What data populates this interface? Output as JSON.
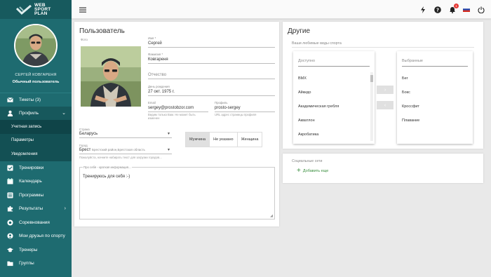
{
  "brand": {
    "line1": "WEB",
    "line2": "SPORT",
    "line3": "PLAN"
  },
  "user": {
    "name": "СЕРГЕЙ КОВГАРЕНЯ",
    "role": "Обычный пользователь"
  },
  "sidebar": {
    "items": [
      {
        "label": "Тикеты (3)",
        "icon": "mail-icon"
      },
      {
        "label": "Профиль",
        "icon": "person-icon"
      },
      {
        "label": "Учетная запись"
      },
      {
        "label": "Параметры"
      },
      {
        "label": "Уведомления"
      },
      {
        "label": "Тренировки",
        "icon": "check-square-icon"
      },
      {
        "label": "Календарь",
        "icon": "calendar-icon"
      },
      {
        "label": "Программы",
        "icon": "list-icon"
      },
      {
        "label": "Результаты",
        "icon": "puzzle-icon"
      },
      {
        "label": "Соревнования",
        "icon": "trophy-icon"
      },
      {
        "label": "Мои друзья по спорту",
        "icon": "friends-icon"
      },
      {
        "label": "Тренеры",
        "icon": "graduation-icon"
      },
      {
        "label": "Группы",
        "icon": "folder-icon"
      }
    ]
  },
  "topbar": {
    "notification_count": "1"
  },
  "profile_form": {
    "title": "Пользователь",
    "photo_label": "Фото",
    "first_name": {
      "label": "Имя *",
      "value": "Сергей"
    },
    "last_name": {
      "label": "Фамилия *",
      "value": "Ковгареня"
    },
    "patronymic": {
      "label": "Отчество"
    },
    "birthday": {
      "label": "День рождения",
      "value": "27 окт. 1975 г."
    },
    "email": {
      "label": "Email",
      "value": "sergey@prostobzor.com",
      "hint": "Видим только Вам. Не может быть изменен"
    },
    "profile": {
      "label": "Профиль",
      "value": "prosto-sergey",
      "hint": "URL адрес страницы профиля"
    },
    "country": {
      "label": "Страна",
      "value": "Беларусь"
    },
    "city": {
      "label": "Город",
      "value": "Брест",
      "region": "Брестский район,Брестская область",
      "hint": "Пожалуйста, начните набирать текст для загрузки городов..."
    },
    "gender": {
      "options": [
        "Мужчина",
        "Не указано",
        "Женщина"
      ],
      "selected": "Мужчина"
    },
    "about": {
      "label": "Про себя - краткая информация...",
      "value": "Тренируюсь для себя :-)"
    }
  },
  "other": {
    "title": "Другие",
    "sports_label": "Ваши любимые виды спорта",
    "available_header": "Доступно",
    "available_items": [
      "BMX",
      "Айкидо",
      "Академическая гребля",
      "Акватлон",
      "Акробатика"
    ],
    "selected_header": "Выбранные",
    "selected_items": [
      "Бег",
      "Бокс",
      "Кроссфит",
      "Плавание"
    ],
    "move_right": "›",
    "move_left": "‹"
  },
  "social": {
    "label": "Социальные сети",
    "add_label": "Добавить еще"
  }
}
